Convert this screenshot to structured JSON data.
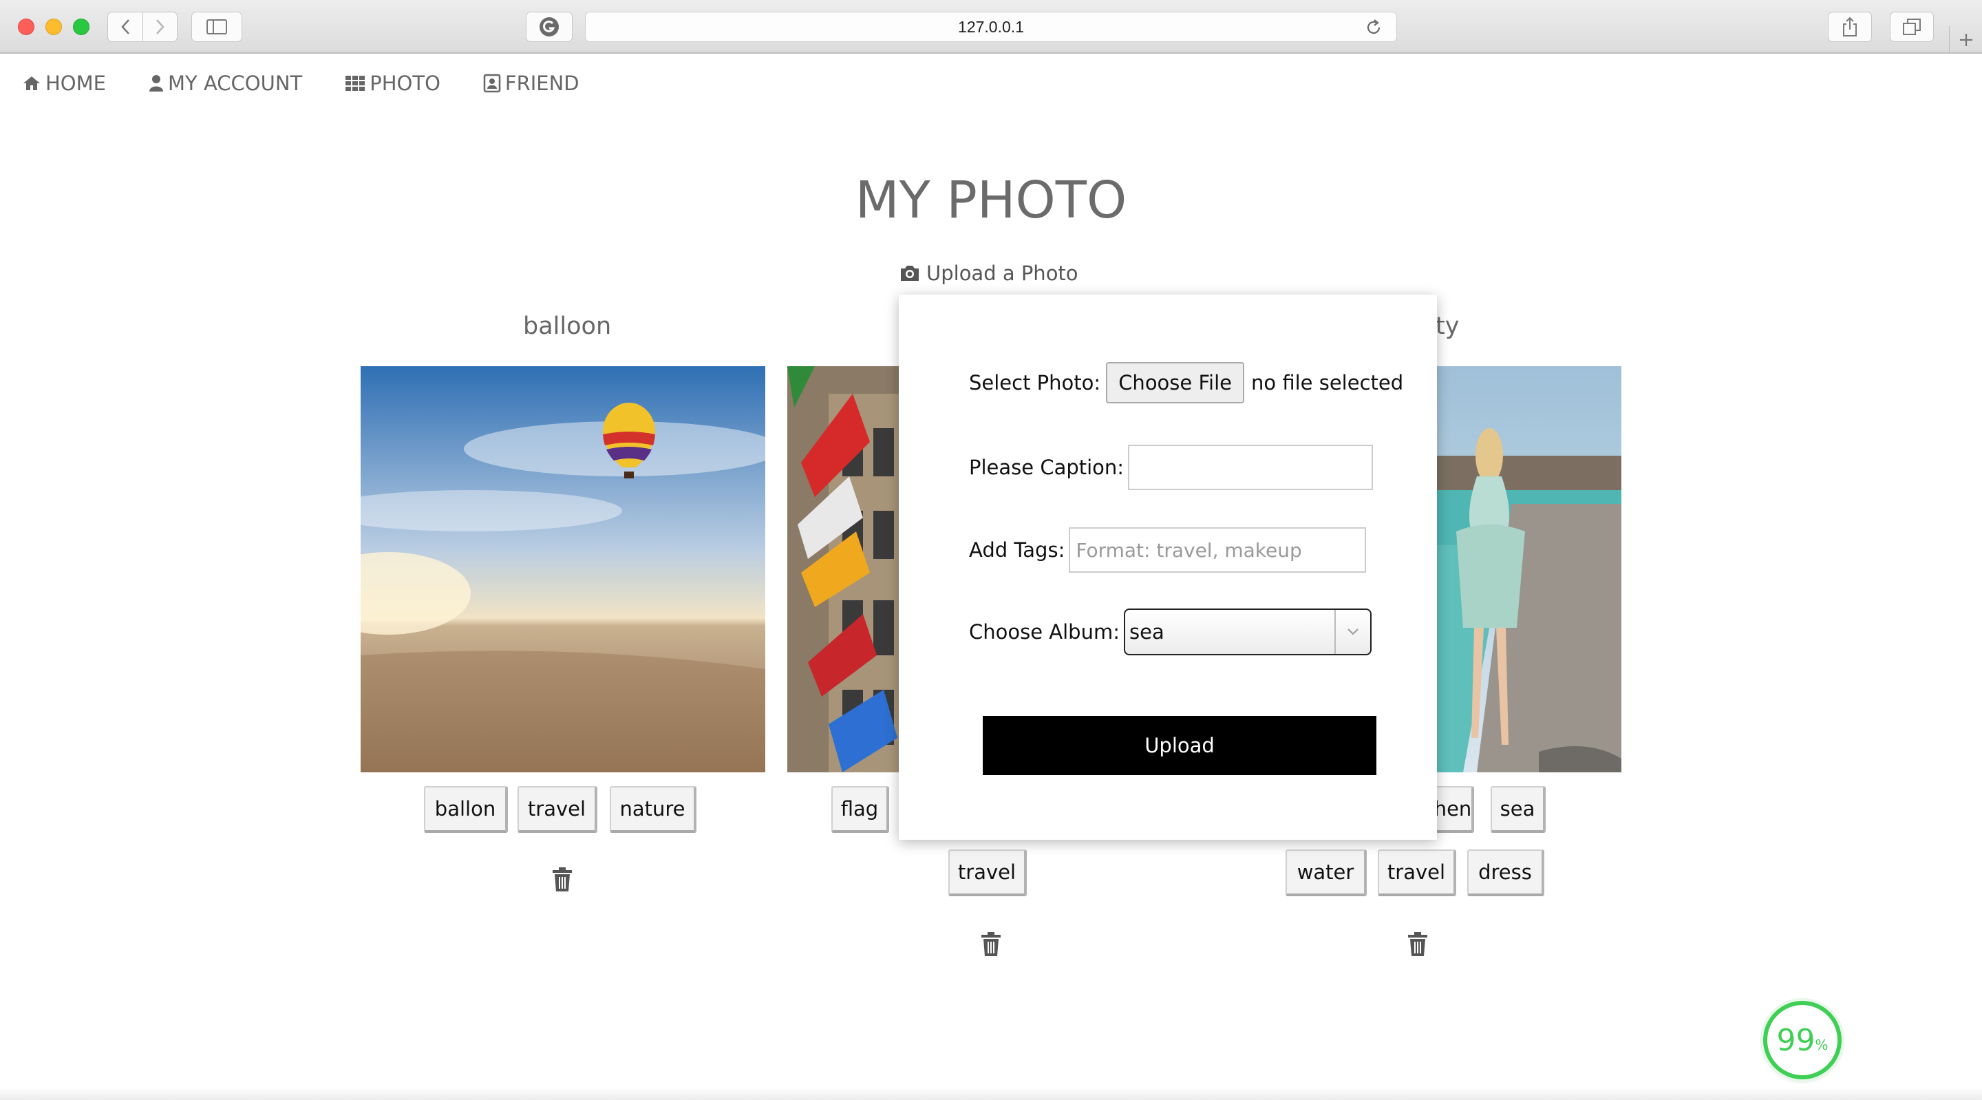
{
  "browser": {
    "url": "127.0.0.1"
  },
  "nav": {
    "items": [
      {
        "label": "HOME",
        "icon": "home-icon"
      },
      {
        "label": "MY ACCOUNT",
        "icon": "user-icon"
      },
      {
        "label": "PHOTO",
        "icon": "grid-icon"
      },
      {
        "label": "FRIEND",
        "icon": "contact-icon"
      }
    ]
  },
  "page": {
    "title": "MY PHOTO",
    "upload_link": "Upload a Photo"
  },
  "albums": [
    {
      "title": "balloon",
      "tags": [
        "ballon",
        "travel",
        "nature"
      ]
    },
    {
      "title": "",
      "tags": [
        "flag",
        "travel"
      ]
    },
    {
      "title": "ty",
      "tags": [
        "hen",
        "sea",
        "water",
        "travel",
        "dress"
      ]
    }
  ],
  "modal": {
    "select_photo_label": "Select Photo:",
    "choose_file_label": "Choose File",
    "no_file_text": "no file selected",
    "caption_label": "Please Caption:",
    "caption_value": "",
    "tags_label": "Add Tags:",
    "tags_placeholder": "Format: travel, makeup",
    "album_label": "Choose Album:",
    "album_selected": "sea",
    "upload_label": "Upload"
  },
  "badge": {
    "value": "99",
    "unit": "%"
  },
  "colors": {
    "accent": "#000000",
    "badge": "#3fcf55"
  }
}
